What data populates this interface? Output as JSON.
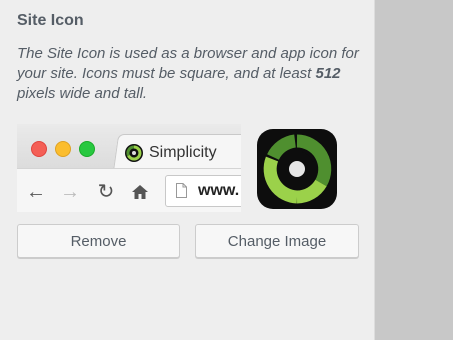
{
  "section": {
    "title": "Site Icon",
    "description_before": "The Site Icon is used as a browser and app icon for your site. Icons must be square, and at least ",
    "description_bold": "512",
    "description_after": " pixels wide and tall."
  },
  "preview": {
    "tab_label": "Simplicity",
    "url_text": "www.",
    "nav_icons": [
      "back-arrow-icon",
      "forward-arrow-icon",
      "reload-icon",
      "home-icon"
    ]
  },
  "buttons": {
    "remove_label": "Remove",
    "change_label": "Change Image"
  },
  "colors": {
    "icon_green_light": "#9bd14a",
    "icon_green_dark": "#4f8f2f",
    "icon_background": "#0d0d0d"
  }
}
